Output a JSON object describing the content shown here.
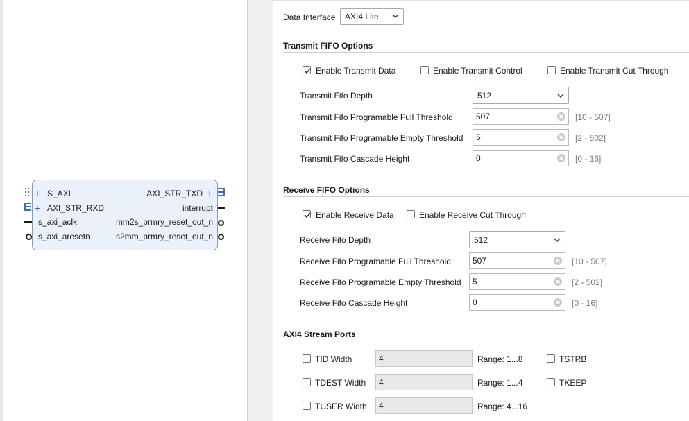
{
  "ip_block": {
    "left_ports": [
      {
        "name": "S_AXI",
        "kind": "bus"
      },
      {
        "name": "AXI_STR_RXD",
        "kind": "bus"
      },
      {
        "name": "s_axi_aclk",
        "kind": "wire"
      },
      {
        "name": "s_axi_aresetn",
        "kind": "inverted"
      }
    ],
    "right_ports": [
      {
        "name": "AXI_STR_TXD",
        "kind": "bus"
      },
      {
        "name": "interrupt",
        "kind": "wire"
      },
      {
        "name": "mm2s_prmry_reset_out_n",
        "kind": "inverted"
      },
      {
        "name": "s2mm_prmry_reset_out_n",
        "kind": "inverted"
      }
    ]
  },
  "data_interface": {
    "label": "Data Interface",
    "value": "AXI4 Lite"
  },
  "transmit": {
    "title": "Transmit FIFO Options",
    "enable_data": {
      "label": "Enable Transmit Data",
      "checked": true
    },
    "enable_control": {
      "label": "Enable Transmit Control",
      "checked": false
    },
    "enable_cut_through": {
      "label": "Enable Transmit Cut Through",
      "checked": false
    },
    "depth": {
      "label": "Transmit Fifo Depth",
      "value": "512"
    },
    "full_threshold": {
      "label": "Transmit Fifo Programable Full Threshold",
      "value": "507",
      "range": "[10 - 507]"
    },
    "empty_threshold": {
      "label": "Transmit Fifo Programable Empty Threshold",
      "value": "5",
      "range": "[2 - 502]"
    },
    "cascade": {
      "label": "Transmit Fifo Cascade Height",
      "value": "0",
      "range": "[0 - 16]"
    }
  },
  "receive": {
    "title": "Receive FIFO Options",
    "enable_data": {
      "label": "Enable Receive Data",
      "checked": true
    },
    "enable_cut_through": {
      "label": "Enable Receive Cut Through",
      "checked": false
    },
    "depth": {
      "label": "Receive Fifo Depth",
      "value": "512"
    },
    "full_threshold": {
      "label": "Receive Fifo Programable Full Threshold",
      "value": "507",
      "range": "[10 - 507]"
    },
    "empty_threshold": {
      "label": "Receive Fifo Programable Empty Threshold",
      "value": "5",
      "range": "[2 - 502]"
    },
    "cascade": {
      "label": "Receive Fifo Cascade Height",
      "value": "0",
      "range": "[0 - 16]"
    }
  },
  "stream": {
    "title": "AXI4 Stream Ports",
    "tid": {
      "label": "TID Width",
      "value": "4",
      "range": "Range: 1...8",
      "checked": false
    },
    "tdest": {
      "label": "TDEST Width",
      "value": "4",
      "range": "Range: 1...4",
      "checked": false
    },
    "tuser": {
      "label": "TUSER Width",
      "value": "4",
      "range": "Range: 4...16",
      "checked": false
    },
    "tstrb": {
      "label": "TSTRB",
      "checked": false
    },
    "tkeep": {
      "label": "TKEEP",
      "checked": false
    }
  },
  "colors": {
    "accent": "#3a6fb0",
    "block_fill": "#eaf1fb",
    "block_border": "#7f9dbe"
  }
}
